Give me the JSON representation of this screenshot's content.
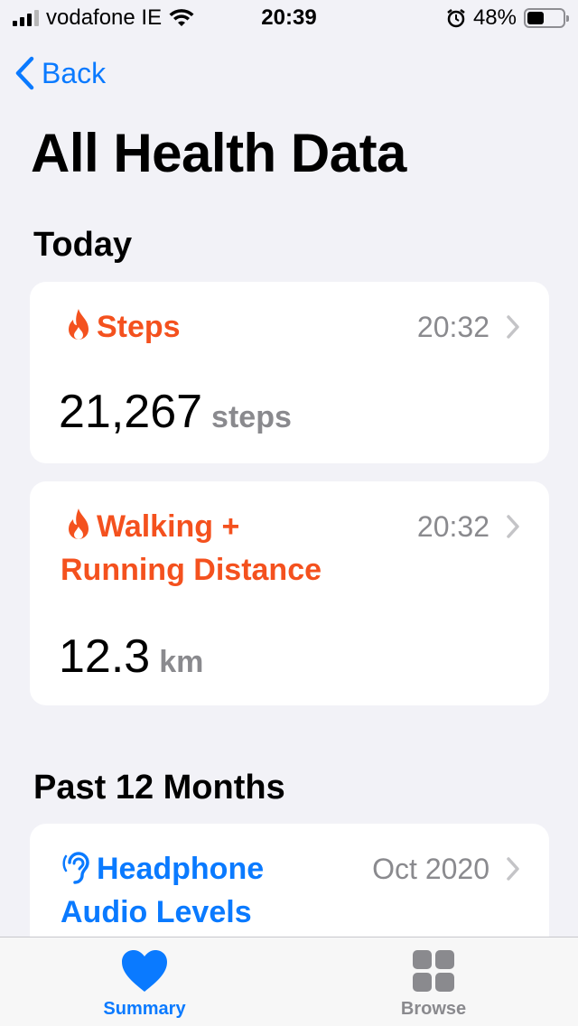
{
  "status_bar": {
    "carrier": "vodafone IE",
    "time": "20:39",
    "battery": "48%",
    "battery_level": 0.48
  },
  "nav": {
    "back_label": "Back"
  },
  "title": "All Health Data",
  "sections": {
    "today": {
      "title": "Today"
    },
    "past": {
      "title": "Past 12 Months"
    }
  },
  "cards": {
    "steps": {
      "title": "Steps",
      "time": "20:32",
      "value": "21,267",
      "unit": "steps"
    },
    "walking": {
      "title_line1": "Walking +",
      "title_line2": "Running Distance",
      "time": "20:32",
      "value": "12.3",
      "unit": "km"
    },
    "headphone": {
      "title_line1": "Headphone",
      "title_line2": "Audio Levels",
      "time": "Oct 2020"
    }
  },
  "tabs": [
    {
      "label": "Summary",
      "icon": "heart-icon",
      "active": true
    },
    {
      "label": "Browse",
      "icon": "grid-icon",
      "active": false
    }
  ],
  "colors": {
    "accent": "#0a7aff",
    "activity": "#f4511e",
    "secondary_text": "#8a8a8e",
    "background": "#f2f2f7"
  }
}
